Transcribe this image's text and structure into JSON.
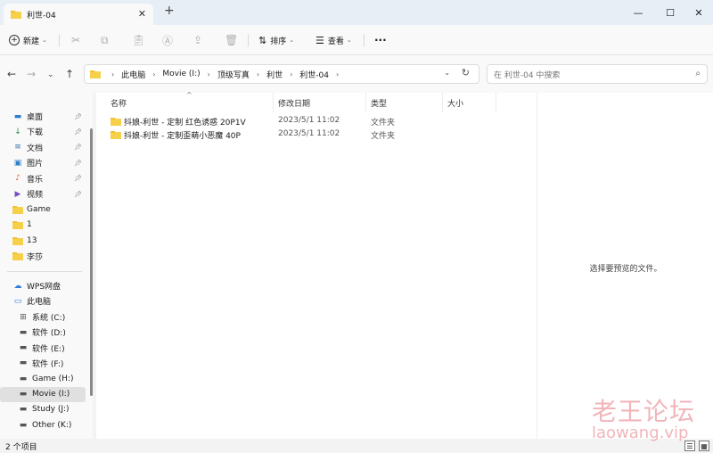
{
  "window": {
    "tab_title": "利世-04",
    "close_tab_glyph": "✕",
    "new_tab_glyph": "+",
    "minimize_glyph": "—",
    "maximize_glyph": "☐",
    "close_glyph": "✕"
  },
  "toolbar": {
    "new_label": "新建",
    "sort_label": "排序",
    "view_label": "查看",
    "more_glyph": "···"
  },
  "address": {
    "crumbs": [
      "此电脑",
      "Movie (I:)",
      "顶级写真",
      "利世",
      "利世-04"
    ],
    "search_placeholder": "在 利世-04 中搜索"
  },
  "sidebar": {
    "quick_access": [
      {
        "label": "桌面",
        "icon": "desktop-icon",
        "color": "#2d7dd2"
      },
      {
        "label": "下载",
        "icon": "download-icon",
        "color": "#1a8a4a"
      },
      {
        "label": "文档",
        "icon": "document-icon",
        "color": "#3b6fb0"
      },
      {
        "label": "图片",
        "icon": "picture-icon",
        "color": "#2f7fc6"
      },
      {
        "label": "音乐",
        "icon": "music-icon",
        "color": "#e0603a"
      },
      {
        "label": "视频",
        "icon": "video-icon",
        "color": "#7a4fc0"
      },
      {
        "label": "Game",
        "icon": "folder-icon",
        "color": "#f1c232"
      },
      {
        "label": "1",
        "icon": "folder-icon",
        "color": "#f1c232"
      },
      {
        "label": "13",
        "icon": "folder-icon",
        "color": "#f1c232"
      },
      {
        "label": "李莎",
        "icon": "folder-icon",
        "color": "#f1c232"
      }
    ],
    "cloud": [
      {
        "label": "WPS网盘",
        "icon": "cloud-icon",
        "color": "#2e7de0"
      },
      {
        "label": "此电脑",
        "icon": "computer-icon",
        "color": "#2d7dd2"
      }
    ],
    "drives": [
      {
        "label": "系统 (C:)",
        "icon": "windows-drive-icon"
      },
      {
        "label": "软件 (D:)",
        "icon": "drive-icon"
      },
      {
        "label": "软件 (E:)",
        "icon": "drive-icon"
      },
      {
        "label": "软件 (F:)",
        "icon": "drive-icon"
      },
      {
        "label": "Game (H:)",
        "icon": "drive-icon"
      },
      {
        "label": "Movie (I:)",
        "icon": "drive-icon",
        "selected": true
      },
      {
        "label": "Study (J:)",
        "icon": "drive-icon"
      },
      {
        "label": "Other (K:)",
        "icon": "drive-icon"
      }
    ]
  },
  "columns": {
    "name": "名称",
    "modified": "修改日期",
    "type": "类型",
    "size": "大小"
  },
  "files": [
    {
      "name": "抖娘-利世 - 定制 红色诱惑 20P1V",
      "modified": "2023/5/1 11:02",
      "type": "文件夹",
      "size": ""
    },
    {
      "name": "抖娘-利世 - 定制歪萌小恶魔 40P",
      "modified": "2023/5/1 11:02",
      "type": "文件夹",
      "size": ""
    }
  ],
  "preview": {
    "message": "选择要预览的文件。"
  },
  "status": {
    "count": "2 个项目"
  },
  "watermark": {
    "cn": "老王论坛",
    "en": "laowang.vip"
  },
  "colors": {
    "folder": "#f1c232",
    "accent": "#0067c0"
  }
}
